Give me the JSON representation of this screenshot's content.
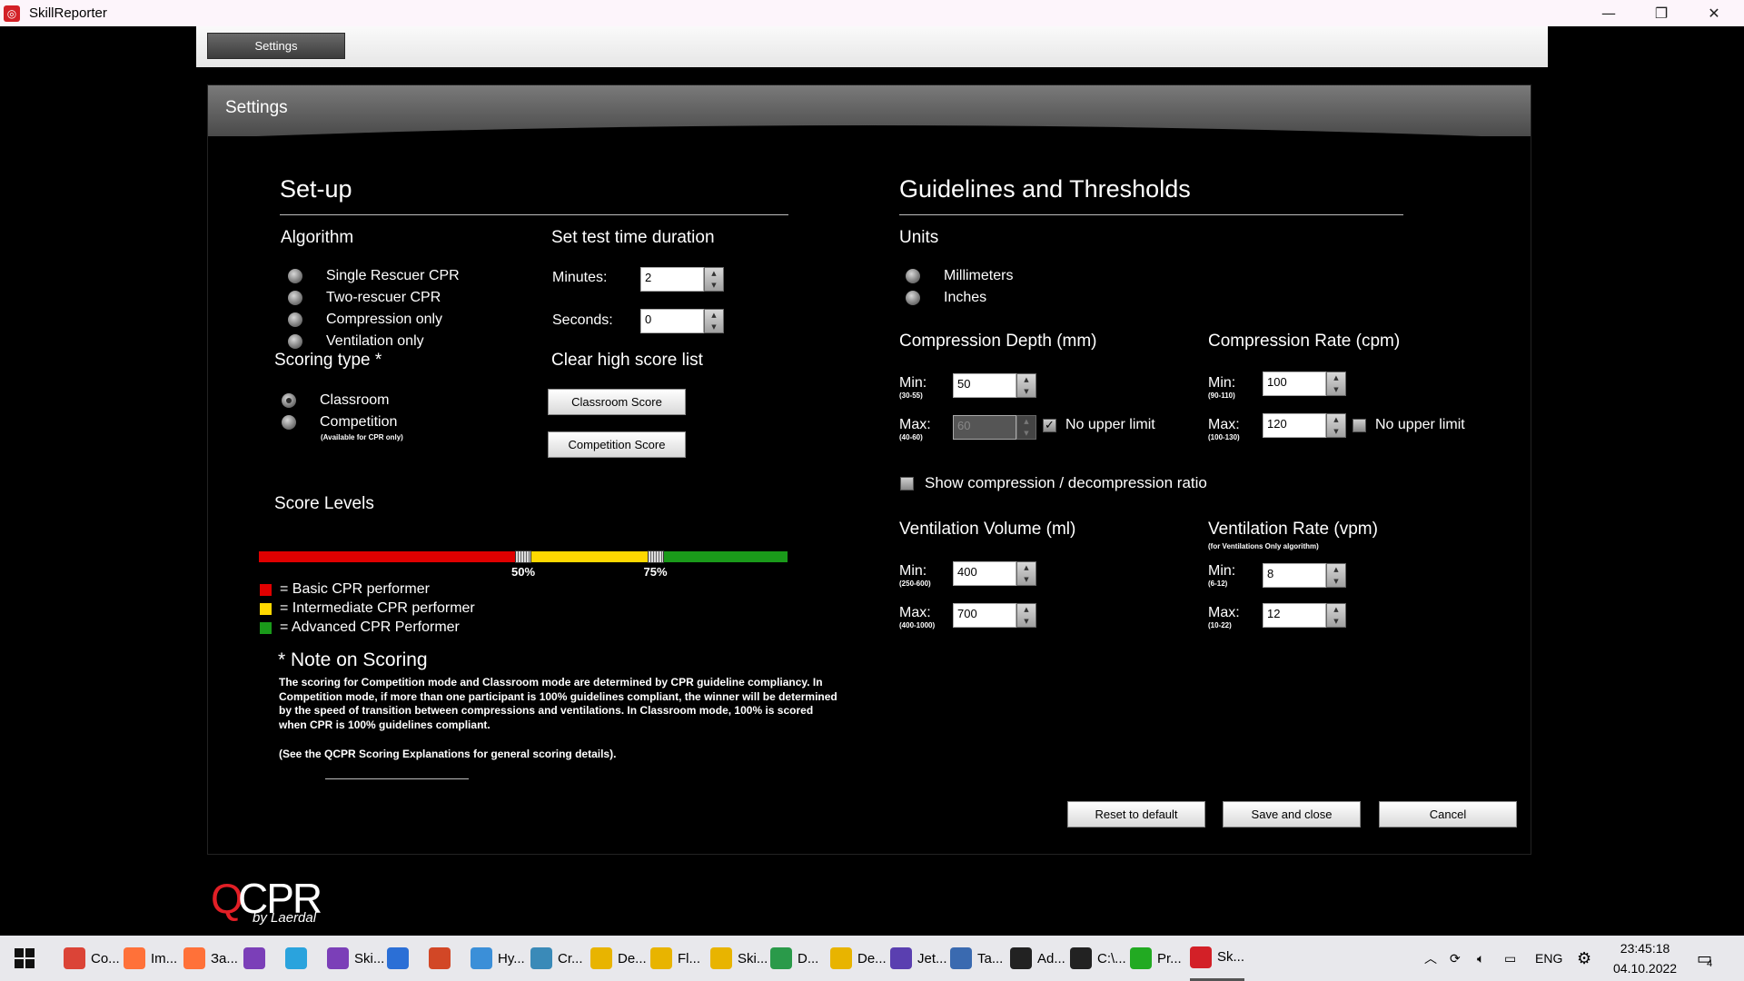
{
  "window": {
    "title": "SkillReporter",
    "minimize": "—",
    "restore": "❐",
    "close": "✕"
  },
  "toolbar": {
    "settings_tab": "Settings"
  },
  "panel": {
    "title": "Settings"
  },
  "setup": {
    "heading": "Set-up",
    "algorithm": {
      "label": "Algorithm",
      "options": [
        "Single Rescuer CPR",
        "Two-rescuer CPR",
        "Compression only",
        "Ventilation only"
      ],
      "selected": null
    },
    "duration": {
      "label": "Set test time duration",
      "minutes_label": "Minutes:",
      "minutes_value": "2",
      "seconds_label": "Seconds:",
      "seconds_value": "0"
    },
    "scoring": {
      "label": "Scoring type *",
      "classroom": "Classroom",
      "competition": "Competition",
      "competition_note": "(Available for CPR only)",
      "selected": "Classroom"
    },
    "clear": {
      "label": "Clear high score list",
      "classroom_btn": "Classroom Score",
      "competition_btn": "Competition Score"
    },
    "score_levels": {
      "label": "Score Levels",
      "thresholds": [
        50,
        75
      ],
      "threshold_labels": [
        "50%",
        "75%"
      ],
      "colors": {
        "basic": "#e00000",
        "intermediate": "#ffd800",
        "advanced": "#1a9a1a"
      },
      "legend": [
        "= Basic CPR performer",
        "= Intermediate CPR performer",
        "= Advanced CPR Performer"
      ]
    },
    "note": {
      "heading": "* Note on Scoring",
      "body": "The scoring for Competition mode and Classroom mode are determined by CPR guideline compliancy. In Competition mode, if more than one participant is 100% guidelines compliant, the winner will be determined by the speed of transition between compressions and ventilations.  In Classroom mode, 100% is scored when CPR is 100% guidelines compliant.",
      "footer": "(See the QCPR Scoring Explanations for general scoring details)."
    }
  },
  "guidelines": {
    "heading": "Guidelines and Thresholds",
    "units": {
      "label": "Units",
      "options": [
        "Millimeters",
        "Inches"
      ]
    },
    "depth": {
      "label": "Compression Depth (mm)",
      "min_label": "Min:",
      "min_range": "(30-55)",
      "min_value": "50",
      "max_label": "Max:",
      "max_range": "(40-60)",
      "max_value": "60",
      "no_upper": "No upper limit",
      "no_upper_checked": true
    },
    "rate": {
      "label": "Compression Rate (cpm)",
      "min_label": "Min:",
      "min_range": "(90-110)",
      "min_value": "100",
      "max_label": "Max:",
      "max_range": "(100-130)",
      "max_value": "120",
      "no_upper": "No upper limit",
      "no_upper_checked": false
    },
    "ratio_label": "Show compression / decompression ratio",
    "vent_volume": {
      "label": "Ventilation Volume (ml)",
      "min_label": "Min:",
      "min_range": "(250-600)",
      "min_value": "400",
      "max_label": "Max:",
      "max_range": "(400-1000)",
      "max_value": "700"
    },
    "vent_rate": {
      "label": "Ventilation Rate (vpm)",
      "sublabel": "(for Ventilations Only algorithm)",
      "min_label": "Min:",
      "min_range": "(6-12)",
      "min_value": "8",
      "max_label": "Max:",
      "max_range": "(10-22)",
      "max_value": "12"
    }
  },
  "actions": {
    "reset": "Reset to default",
    "save": "Save and close",
    "cancel": "Cancel"
  },
  "logo": {
    "q": "Q",
    "cpr": "CPR",
    "by": "by Laerdal"
  },
  "taskbar": {
    "items": [
      "Co...",
      "Im...",
      "За...",
      "",
      "",
      "Ski...",
      "",
      "",
      "Hy...",
      "Cr...",
      "De...",
      "Fl...",
      "Ski...",
      "D...",
      "De...",
      "Jet...",
      "Ta...",
      "Ad...",
      "C:\\...",
      "Pr...",
      "Sk..."
    ],
    "lang": "ENG",
    "time": "23:45:18",
    "date": "04.10.2022",
    "notifications": "4"
  }
}
